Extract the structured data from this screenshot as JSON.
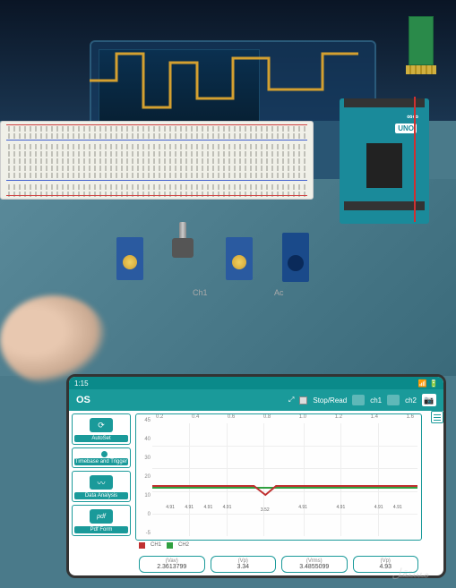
{
  "arduino": {
    "brand": "∞∞",
    "model": "UNO"
  },
  "circuit": {
    "ch1_label": "Ch1",
    "ac_label": "Ac"
  },
  "phone": {
    "status_time": "1:15",
    "app_title": "OS",
    "header": {
      "stop_read": "Stop/Read",
      "ch1": "ch1",
      "ch2": "ch2"
    },
    "sidebar": {
      "autoset": "AutoSet",
      "timebase": "Timebase and Trigger",
      "analysis": "Data Analysis",
      "pdf": "Pdf Form",
      "pdf_icon": "pdf"
    },
    "legend": {
      "ch1": "CH1",
      "ch2": "CH2"
    },
    "stats": [
      {
        "label": "(Vav)",
        "value": "2.3613799"
      },
      {
        "label": "(Vp)",
        "value": "3.34"
      },
      {
        "label": "(Vrms)",
        "value": "3.4855099"
      },
      {
        "label": "(Vp)",
        "value": "4.93"
      }
    ]
  },
  "chart_data": {
    "type": "line",
    "title": "",
    "xlabel": "",
    "ylabel": "",
    "x_ticks": [
      "0.2",
      "0.4",
      "0.6",
      "0.8",
      "1.0",
      "1.2",
      "1.4",
      "1.6"
    ],
    "y_ticks": [
      "45",
      "40",
      "30",
      "20",
      "10",
      "0",
      "-5"
    ],
    "ylim": [
      -5,
      45
    ],
    "xlim": [
      0.2,
      1.6
    ],
    "series": [
      {
        "name": "CH1",
        "color": "#c03030",
        "x": [
          0.2,
          0.3,
          0.4,
          0.5,
          0.6,
          0.7,
          0.8,
          0.9,
          1.0,
          1.1,
          1.2,
          1.3,
          1.4,
          1.5,
          1.6
        ],
        "y": [
          4.91,
          4.91,
          4.91,
          4.91,
          4.91,
          4.91,
          3.52,
          4.91,
          4.91,
          4.91,
          4.91,
          4.91,
          4.91,
          4.91,
          4.91
        ]
      },
      {
        "name": "CH2",
        "color": "#30a040",
        "x": [
          0.2,
          1.6
        ],
        "y": [
          5,
          5
        ]
      }
    ],
    "annotations": [
      {
        "x": 0.3,
        "y": 4.91,
        "text": "4.91"
      },
      {
        "x": 0.4,
        "y": 4.91,
        "text": "4.91"
      },
      {
        "x": 0.5,
        "y": 4.91,
        "text": "4.91"
      },
      {
        "x": 0.6,
        "y": 4.91,
        "text": "4.91"
      },
      {
        "x": 0.8,
        "y": 3.52,
        "text": "3.52"
      },
      {
        "x": 1.0,
        "y": 4.91,
        "text": "4.91"
      },
      {
        "x": 1.2,
        "y": 4.91,
        "text": "4.91"
      },
      {
        "x": 1.4,
        "y": 4.91,
        "text": "4.91"
      },
      {
        "x": 1.5,
        "y": 4.91,
        "text": "4.91"
      }
    ]
  },
  "watermark": "مستقل"
}
